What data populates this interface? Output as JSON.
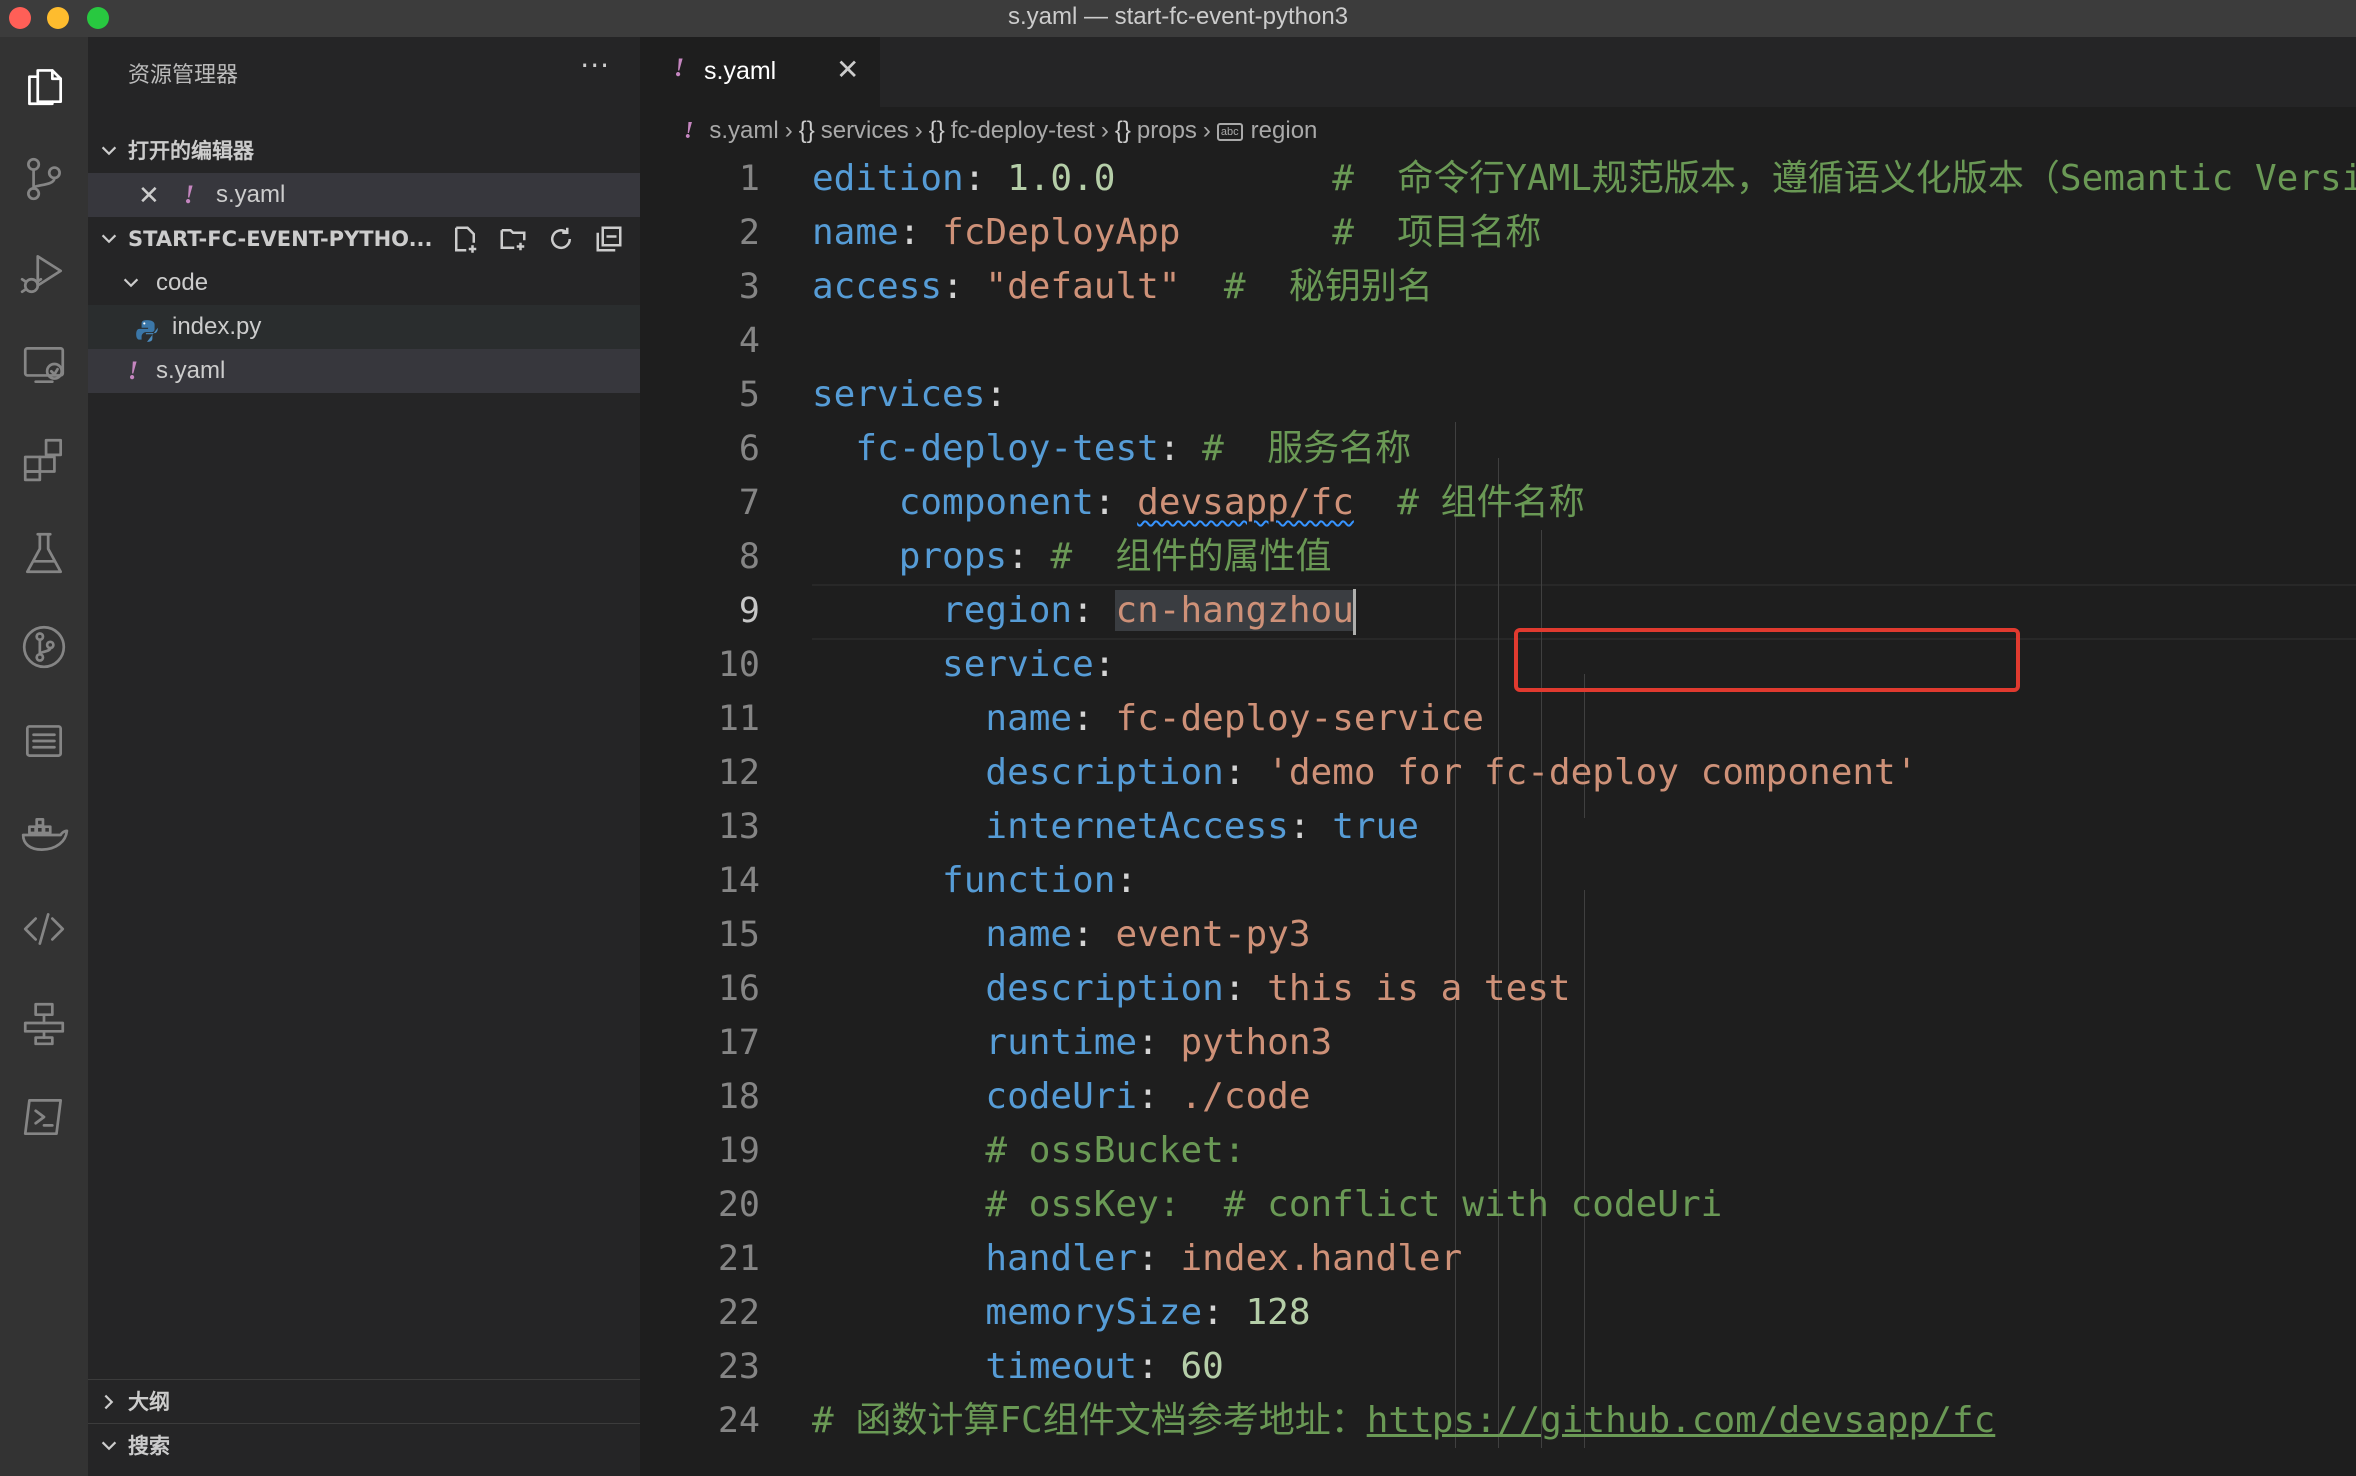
{
  "window": {
    "title": "s.yaml — start-fc-event-python3"
  },
  "activity_bar": {
    "items": [
      {
        "name": "explorer",
        "active": true
      },
      {
        "name": "source-control"
      },
      {
        "name": "run-debug"
      },
      {
        "name": "remote-explorer"
      },
      {
        "name": "extensions"
      },
      {
        "name": "testing"
      },
      {
        "name": "gitlens"
      },
      {
        "name": "outline-list"
      },
      {
        "name": "docker"
      },
      {
        "name": "api"
      },
      {
        "name": "workflow"
      },
      {
        "name": "terminal"
      }
    ]
  },
  "sidebar": {
    "title": "资源管理器",
    "more": "···",
    "open_editors": {
      "label": "打开的编辑器",
      "items": [
        {
          "bang": "!",
          "name": "s.yaml"
        }
      ]
    },
    "project": {
      "label": "START-FC-EVENT-PYTHO...",
      "folder": "code",
      "files": [
        {
          "name": "index.py",
          "type": "python"
        },
        {
          "bang": "!",
          "name": "s.yaml",
          "type": "yaml"
        }
      ]
    },
    "outline_label": "大纲",
    "search_label": "搜索"
  },
  "tabs": [
    {
      "bang": "!",
      "label": "s.yaml",
      "close": "✕"
    }
  ],
  "breadcrumb": {
    "bang": "!",
    "file": "s.yaml",
    "obj_icon": "{}",
    "parts": [
      "services",
      "fc-deploy-test",
      "props"
    ],
    "key_icon": "abc",
    "last": "region"
  },
  "editor": {
    "current_line": 9,
    "lines": [
      {
        "n": "1",
        "t": [
          [
            "k",
            "edition"
          ],
          [
            "p",
            ": "
          ],
          [
            "n",
            "1.0.0"
          ],
          [
            "c",
            "          #  命令行YAML规范版本，遵循语义化版本（Semantic Versi"
          ]
        ]
      },
      {
        "n": "2",
        "t": [
          [
            "k",
            "name"
          ],
          [
            "p",
            ": "
          ],
          [
            "s",
            "fcDeployApp"
          ],
          [
            "c",
            "       #  项目名称"
          ]
        ]
      },
      {
        "n": "3",
        "t": [
          [
            "k",
            "access"
          ],
          [
            "p",
            ": "
          ],
          [
            "s",
            "\"default\""
          ],
          [
            "c",
            "  #  秘钥别名"
          ]
        ]
      },
      {
        "n": "4",
        "t": []
      },
      {
        "n": "5",
        "t": [
          [
            "k",
            "services"
          ],
          [
            "p",
            ":"
          ]
        ]
      },
      {
        "n": "6",
        "t": [
          [
            "p",
            "  "
          ],
          [
            "k",
            "fc-deploy-test"
          ],
          [
            "p",
            ": "
          ],
          [
            "c",
            "#  服务名称"
          ]
        ]
      },
      {
        "n": "7",
        "t": [
          [
            "p",
            "    "
          ],
          [
            "k",
            "component"
          ],
          [
            "p",
            ": "
          ],
          [
            "sq",
            "devsapp/fc"
          ],
          [
            "c",
            "  # 组件名称"
          ]
        ]
      },
      {
        "n": "8",
        "t": [
          [
            "p",
            "    "
          ],
          [
            "k",
            "props"
          ],
          [
            "p",
            ": "
          ],
          [
            "c",
            "#  组件的属性值"
          ]
        ]
      },
      {
        "n": "9",
        "t": [
          [
            "p",
            "      "
          ],
          [
            "k",
            "region"
          ],
          [
            "p",
            ": "
          ],
          [
            "sel",
            "cn-hangzhou"
          ],
          [
            "cur",
            ""
          ]
        ]
      },
      {
        "n": "10",
        "t": [
          [
            "p",
            "      "
          ],
          [
            "k",
            "service"
          ],
          [
            "p",
            ":"
          ]
        ]
      },
      {
        "n": "11",
        "t": [
          [
            "p",
            "        "
          ],
          [
            "k",
            "name"
          ],
          [
            "p",
            ": "
          ],
          [
            "s",
            "fc-deploy-service"
          ]
        ]
      },
      {
        "n": "12",
        "t": [
          [
            "p",
            "        "
          ],
          [
            "k",
            "description"
          ],
          [
            "p",
            ": "
          ],
          [
            "s",
            "'demo for fc-deploy component'"
          ]
        ]
      },
      {
        "n": "13",
        "t": [
          [
            "p",
            "        "
          ],
          [
            "k",
            "internetAccess"
          ],
          [
            "p",
            ": "
          ],
          [
            "b",
            "true"
          ]
        ]
      },
      {
        "n": "14",
        "t": [
          [
            "p",
            "      "
          ],
          [
            "k",
            "function"
          ],
          [
            "p",
            ":"
          ]
        ]
      },
      {
        "n": "15",
        "t": [
          [
            "p",
            "        "
          ],
          [
            "k",
            "name"
          ],
          [
            "p",
            ": "
          ],
          [
            "s",
            "event-py3"
          ]
        ]
      },
      {
        "n": "16",
        "t": [
          [
            "p",
            "        "
          ],
          [
            "k",
            "description"
          ],
          [
            "p",
            ": "
          ],
          [
            "s",
            "this is a test"
          ]
        ]
      },
      {
        "n": "17",
        "t": [
          [
            "p",
            "        "
          ],
          [
            "k",
            "runtime"
          ],
          [
            "p",
            ": "
          ],
          [
            "s",
            "python3"
          ]
        ]
      },
      {
        "n": "18",
        "t": [
          [
            "p",
            "        "
          ],
          [
            "k",
            "codeUri"
          ],
          [
            "p",
            ": "
          ],
          [
            "s",
            "./code"
          ]
        ]
      },
      {
        "n": "19",
        "t": [
          [
            "p",
            "        "
          ],
          [
            "c",
            "# ossBucket:"
          ]
        ]
      },
      {
        "n": "20",
        "t": [
          [
            "p",
            "        "
          ],
          [
            "c",
            "# ossKey:  # conflict with codeUri"
          ]
        ]
      },
      {
        "n": "21",
        "t": [
          [
            "p",
            "        "
          ],
          [
            "k",
            "handler"
          ],
          [
            "p",
            ": "
          ],
          [
            "s",
            "index.handler"
          ]
        ]
      },
      {
        "n": "22",
        "t": [
          [
            "p",
            "        "
          ],
          [
            "k",
            "memorySize"
          ],
          [
            "p",
            ": "
          ],
          [
            "n",
            "128"
          ]
        ]
      },
      {
        "n": "23",
        "t": [
          [
            "p",
            "        "
          ],
          [
            "k",
            "timeout"
          ],
          [
            "p",
            ": "
          ],
          [
            "n",
            "60"
          ]
        ]
      },
      {
        "n": "24",
        "t": [
          [
            "c",
            "# 函数计算FC组件文档参考地址："
          ],
          [
            "u",
            "https://github.com/devsapp/fc"
          ]
        ]
      }
    ]
  },
  "colors": {
    "keyword": "#569cd6",
    "string": "#ce9178",
    "number": "#b5cea8",
    "comment": "#6a9955",
    "highlight_box": "#e03a2f"
  }
}
